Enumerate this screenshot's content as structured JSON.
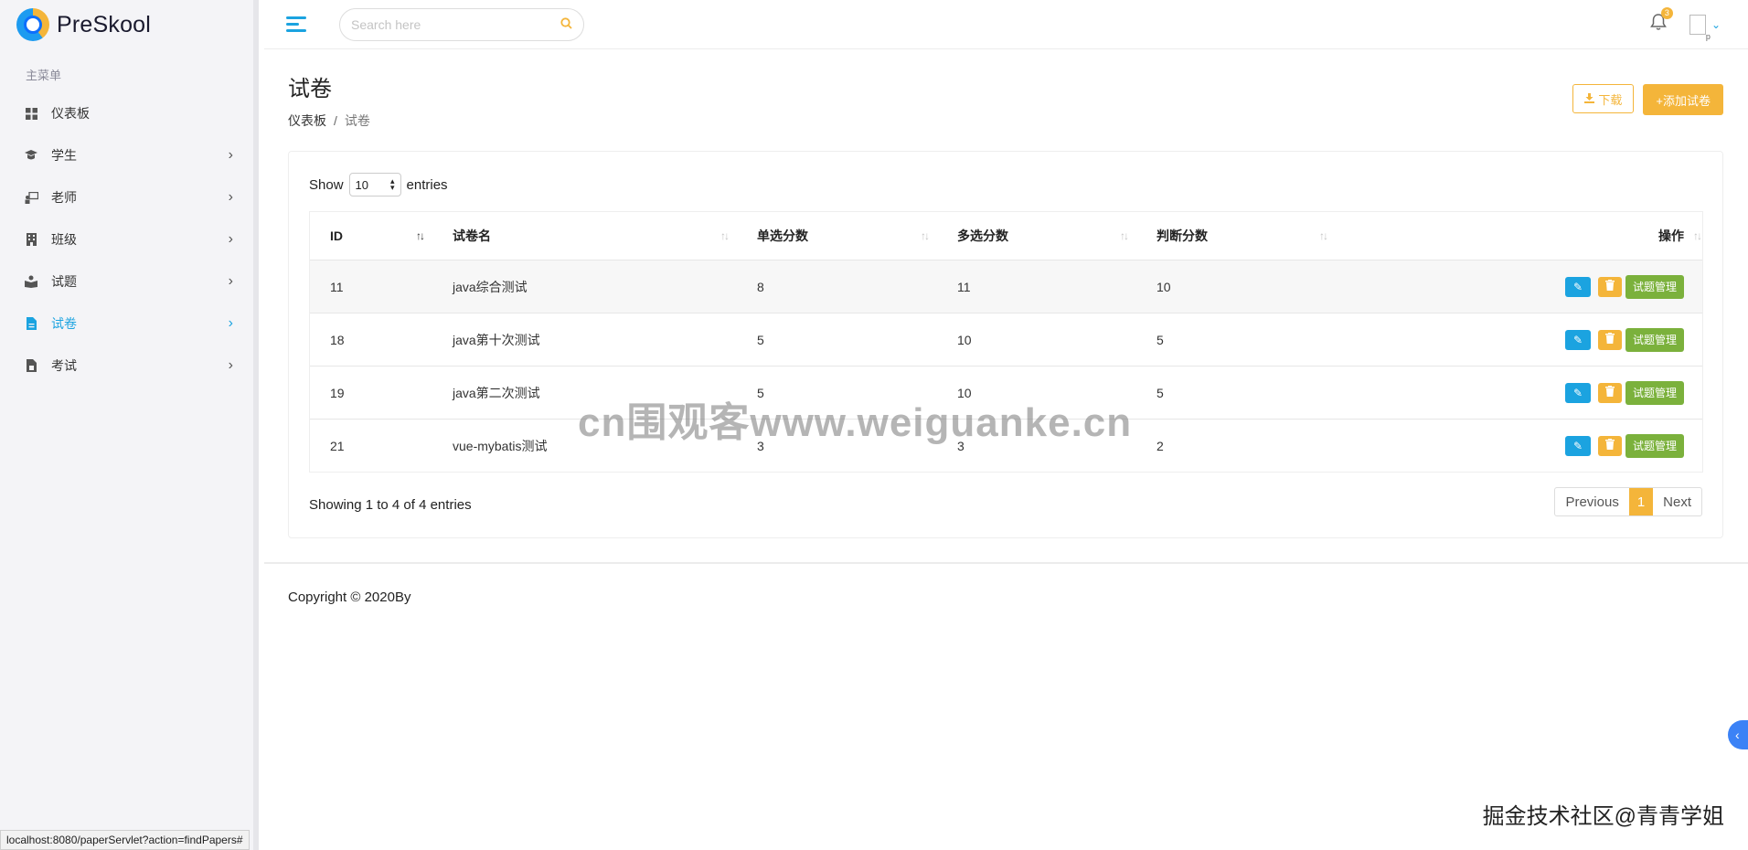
{
  "brand": {
    "name": "PreSkool"
  },
  "sidebar": {
    "menu_title": "主菜单",
    "items": [
      {
        "label": "仪表板",
        "icon": "grid-icon",
        "chevron": false
      },
      {
        "label": "学生",
        "icon": "graduation-cap-icon",
        "chevron": true
      },
      {
        "label": "老师",
        "icon": "chalkboard-teacher-icon",
        "chevron": true
      },
      {
        "label": "班级",
        "icon": "building-icon",
        "chevron": true
      },
      {
        "label": "试题",
        "icon": "book-reader-icon",
        "chevron": true
      },
      {
        "label": "试卷",
        "icon": "file-icon",
        "chevron": true,
        "active": true
      },
      {
        "label": "考试",
        "icon": "clipboard-icon",
        "chevron": true
      }
    ]
  },
  "header": {
    "search_placeholder": "Search here",
    "notification_count": "3"
  },
  "page": {
    "title": "试卷",
    "breadcrumb": {
      "home": "仪表板",
      "current": "试卷"
    },
    "download_label": "下载",
    "add_label": "+添加试卷"
  },
  "table": {
    "show_label": "Show",
    "page_size": "10",
    "entries_label": "entries",
    "columns": [
      "ID",
      "试卷名",
      "单选分数",
      "多选分数",
      "判断分数",
      "操作"
    ],
    "rows": [
      {
        "id": "11",
        "name": "java综合测试",
        "single": "8",
        "multi": "11",
        "judge": "10"
      },
      {
        "id": "18",
        "name": "java第十次测试",
        "single": "5",
        "multi": "10",
        "judge": "5"
      },
      {
        "id": "19",
        "name": "java第二次测试",
        "single": "5",
        "multi": "10",
        "judge": "5"
      },
      {
        "id": "21",
        "name": "vue-mybatis测试",
        "single": "3",
        "multi": "3",
        "judge": "2"
      }
    ],
    "manage_label": "试题管理",
    "info": "Showing 1 to 4 of 4 entries",
    "pager": {
      "previous": "Previous",
      "current": "1",
      "next": "Next"
    }
  },
  "footer": {
    "copyright": "Copyright © 2020By"
  },
  "status_url": "localhost:8080/paperServlet?action=findPapers#",
  "watermark": "cn围观客www.weiguanke.cn",
  "corner_mark": "掘金技术社区@青青学姐",
  "colors": {
    "accent": "#1ba3e0",
    "warning": "#f4b53a",
    "success": "#7bb13c"
  }
}
